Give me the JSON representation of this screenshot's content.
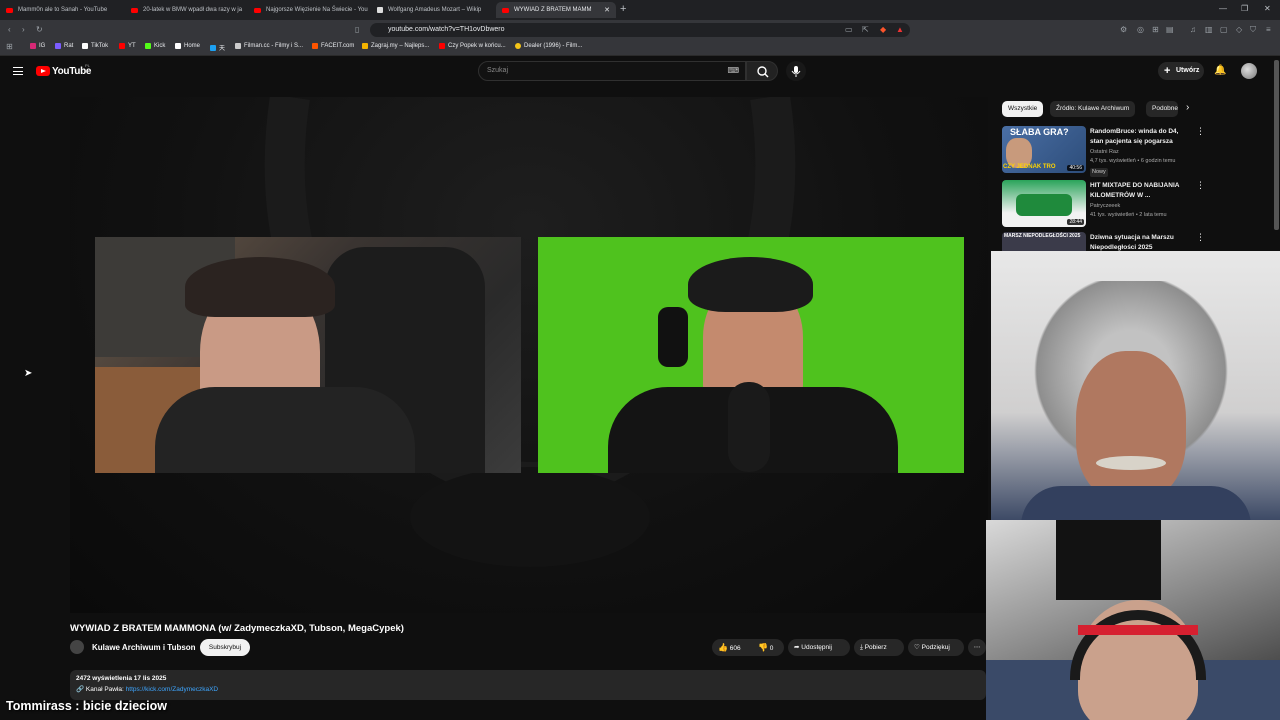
{
  "browser": {
    "tabs": [
      {
        "label": "Mamm0n ale to Sanah - YouTube",
        "favicon": "youtube-icon"
      },
      {
        "label": "20-latek w BMW wpadł dwa razy w ja",
        "favicon": "youtube-icon"
      },
      {
        "label": "Najgorsze Więzienie Na Świecie - You",
        "favicon": "youtube-icon"
      },
      {
        "label": "Wolfgang Amadeus Mozart – Wikip",
        "favicon": "wikipedia-icon"
      },
      {
        "label": "WYWIAD Z BRATEM MAMM",
        "favicon": "youtube-icon",
        "active": true
      }
    ],
    "url": "youtube.com/watch?v=TH1ovDbwero",
    "bookmarks": [
      {
        "label": "IG",
        "color": "#d62976"
      },
      {
        "label": "Rat",
        "color": "#7b5cff"
      },
      {
        "label": "TikTok",
        "color": "#ffffff"
      },
      {
        "label": "YT",
        "color": "#ff0000"
      },
      {
        "label": "Kick",
        "color": "#53fc18"
      },
      {
        "label": "Home",
        "color": "#ffffff"
      },
      {
        "label": "天",
        "color": "#1da1f2"
      },
      {
        "label": "Filman.cc - Filmy i S...",
        "color": "#cccccc"
      },
      {
        "label": "FACEIT.com",
        "color": "#ff5500"
      },
      {
        "label": "Zagraj.my – Najleps...",
        "color": "#f4b400"
      },
      {
        "label": "Czy Popek w końcu...",
        "color": "#ff0000"
      },
      {
        "label": "Dealer (1996) - Film...",
        "color": "#f5c518"
      }
    ]
  },
  "masthead": {
    "logo_text": "YouTube",
    "region": "PL",
    "search_placeholder": "Szukaj",
    "create_label": "Utwórz"
  },
  "video": {
    "title": "WYWIAD Z BRATEM MAMMONA (w/ ZadymeczkaXD, Tubson, MegaCypek)",
    "channel": "Kulawe Archiwum i Tubson",
    "subscribe_label": "Subskrybuj",
    "likes": "606",
    "dislikes": "0",
    "share_label": "Udostępnij",
    "download_label": "Pobierz",
    "thanks_label": "Podziękuj",
    "more_label": "⋯",
    "views_line": "2472 wyświetlenia  17 lis 2025",
    "kanal_prefix": "🔗 Kanał Pawła: ",
    "kanal_link": "https://kick.com/ZadymeczkaXD"
  },
  "sidebar": {
    "chips": [
      "Wszystkie",
      "Źródło: Kulawe Archiwum",
      "Podobne"
    ],
    "recommendations": [
      {
        "title": "RandomBruce: winda do D4, stan pacjenta się pogarsza",
        "channel": "Ostatni Raz",
        "meta": "4,7 tys. wyświetleń • 6 godzin temu",
        "badge": "Nowy",
        "duration": "40:56",
        "thumb_text": "SŁABA GRA?",
        "thumb_text2": "CZY JEDNAK TRO"
      },
      {
        "title": "HIT MIXTAPE DO NABIJANIA KILOMETRÓW W ...",
        "channel": "Patryczeeek",
        "meta": "41 tys. wyświetleń • 2 lata temu",
        "duration": "28:44"
      },
      {
        "title": "Dziwna sytuacja na Marszu Niepodległości 2025",
        "thumb_text": "MARSZ NIEPODLEGŁOŚCI 2025"
      }
    ]
  },
  "overlay": {
    "text": "Tommirass : bicie dzieciow"
  }
}
